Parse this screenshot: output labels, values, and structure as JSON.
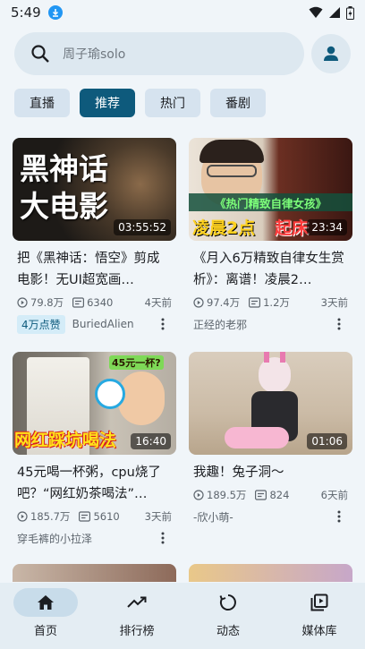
{
  "status_bar": {
    "time": "5:49"
  },
  "search": {
    "placeholder": "周子瑜solo"
  },
  "chips": [
    {
      "label": "直播"
    },
    {
      "label": "推荐"
    },
    {
      "label": "热门"
    },
    {
      "label": "番剧"
    }
  ],
  "videos": [
    {
      "thumb_text": "黑神话\n大电影",
      "duration": "03:55:52",
      "title": "把《黑神话：悟空》剪成电影！无UI超宽画…",
      "views": "79.8万",
      "danmaku": "6340",
      "when": "4天前",
      "badge": "4万点赞",
      "author": "BuriedAlien"
    },
    {
      "thumb_text": "《热门精致自律女孩》",
      "thumb_text2": "凌晨2点",
      "thumb_text3": "起床",
      "duration": "23:34",
      "title": "《月入6万精致自律女生赏析》：离谱！凌晨2…",
      "views": "97.4万",
      "danmaku": "1.2万",
      "when": "3天前",
      "author": "正经的老邪"
    },
    {
      "thumb_text": "网红踩坑喝法",
      "thumb_text2": "45元一杯?",
      "duration": "16:40",
      "title": "45元喝一杯粥，cpu烧了吧？“网红奶茶喝法”…",
      "views": "185.7万",
      "danmaku": "5610",
      "when": "3天前",
      "author": "穿毛裤的小拉泽"
    },
    {
      "duration": "01:06",
      "title": "我趣！兔子洞～",
      "views": "189.5万",
      "danmaku": "824",
      "when": "6天前",
      "author": "-欣小萌-"
    }
  ],
  "nav": [
    {
      "label": "首页",
      "icon": "home-icon"
    },
    {
      "label": "排行榜",
      "icon": "trending-icon"
    },
    {
      "label": "动态",
      "icon": "refresh-icon"
    },
    {
      "label": "媒体库",
      "icon": "library-icon"
    }
  ],
  "colors": {
    "accent": "#0e5a7c",
    "download": "#2196f3"
  }
}
